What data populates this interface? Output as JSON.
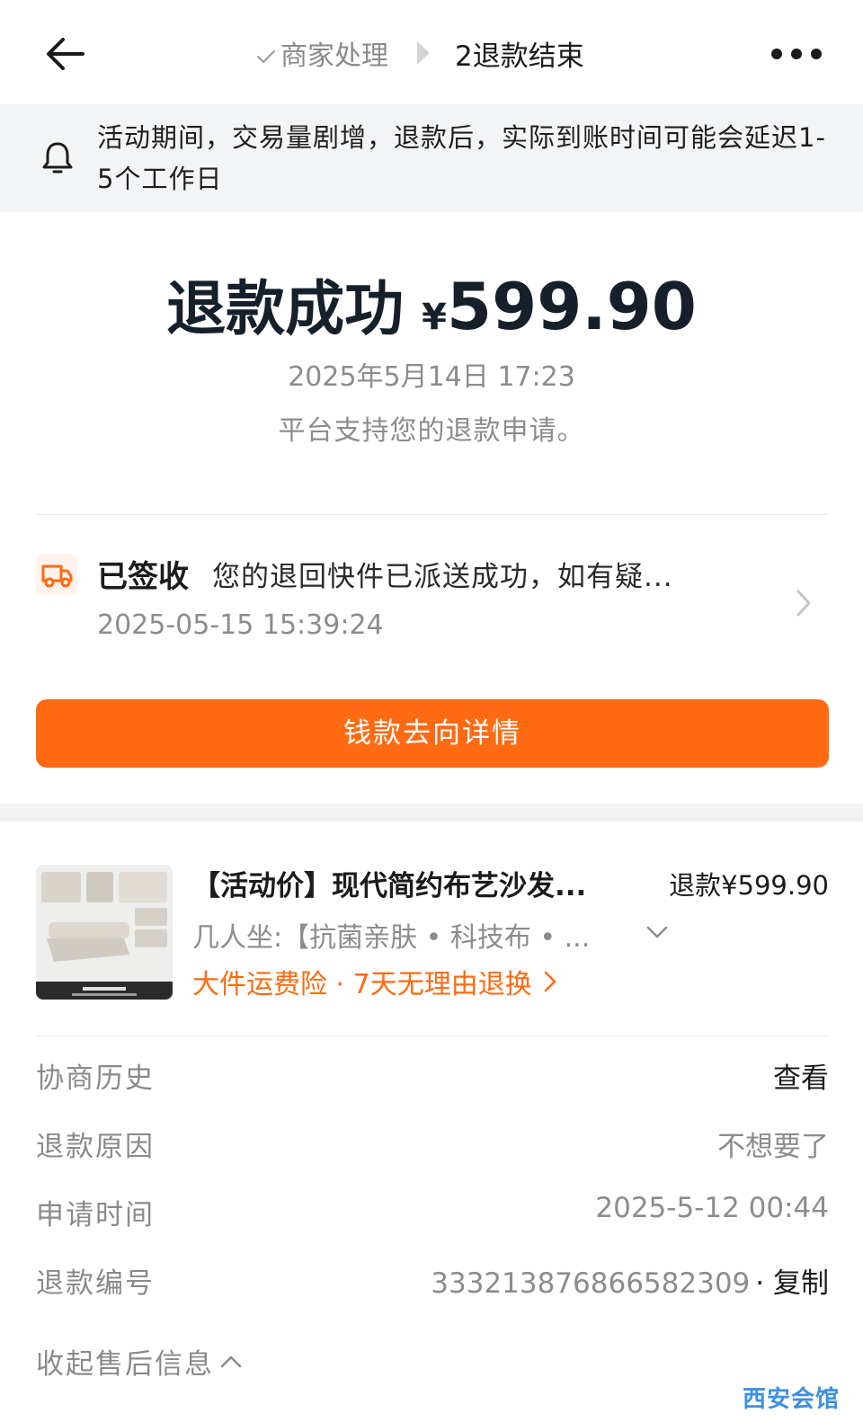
{
  "header": {
    "step_done_label": "商家处理",
    "step_current_label": "2退款结束"
  },
  "notice": {
    "text": "活动期间，交易量剧增，退款后，实际到账时间可能会延迟1-5个工作日"
  },
  "result": {
    "status": "退款成功",
    "currency": "¥",
    "amount": "599.90",
    "time": "2025年5月14日 17:23",
    "description": "平台支持您的退款申请。"
  },
  "logistics": {
    "status": "已签收",
    "message": "您的退回快件已派送成功，如有疑...",
    "time": "2025-05-15 15:39:24"
  },
  "money_button": {
    "label": "钱款去向详情"
  },
  "product": {
    "name": "【活动价】现代简约布艺沙发...",
    "refund": "退款¥599.90",
    "sku": "几人坐:【抗菌亲肤 • 科技布 • ...",
    "service": "大件运费险 · 7天无理由退换"
  },
  "info": {
    "history_label": "协商历史",
    "history_value": "查看",
    "reason_label": "退款原因",
    "reason_value": "不想要了",
    "apply_time_label": "申请时间",
    "apply_time_value": "2025-5-12 00:44",
    "refund_no_label": "退款编号",
    "refund_no_value": "333213876866582309",
    "copy_label": "· 复制",
    "collapse_label": "收起售后信息"
  },
  "watermark": "西安会馆",
  "icons": {
    "back": "back-arrow-icon",
    "more": "more-icon",
    "bell": "bell-icon",
    "truck": "truck-icon"
  },
  "colors": {
    "accent": "#ff6a12",
    "notice_bg": "#f2f4f6",
    "muted_text": "#8c8c8c"
  }
}
